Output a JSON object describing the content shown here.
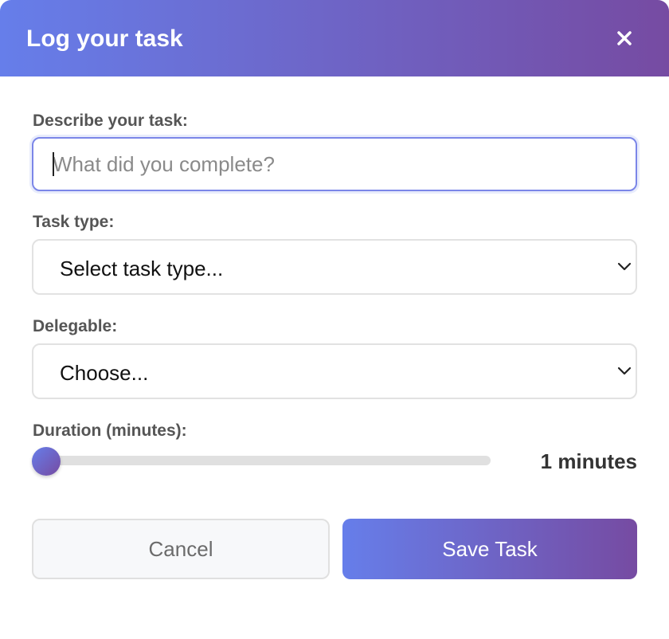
{
  "modal": {
    "title": "Log your task",
    "close_icon": "close-icon"
  },
  "form": {
    "description": {
      "label": "Describe your task:",
      "placeholder": "What did you complete?",
      "value": ""
    },
    "task_type": {
      "label": "Task type:",
      "selected": "Select task type..."
    },
    "delegable": {
      "label": "Delegable:",
      "selected": "Choose..."
    },
    "duration": {
      "label": "Duration (minutes):",
      "value": "1",
      "unit": "minutes",
      "slider_fraction": 0.0
    }
  },
  "buttons": {
    "cancel": "Cancel",
    "save": "Save Task"
  },
  "colors": {
    "gradient_start": "#667eea",
    "gradient_end": "#764ba2",
    "input_focus_border": "#7b86e8"
  }
}
